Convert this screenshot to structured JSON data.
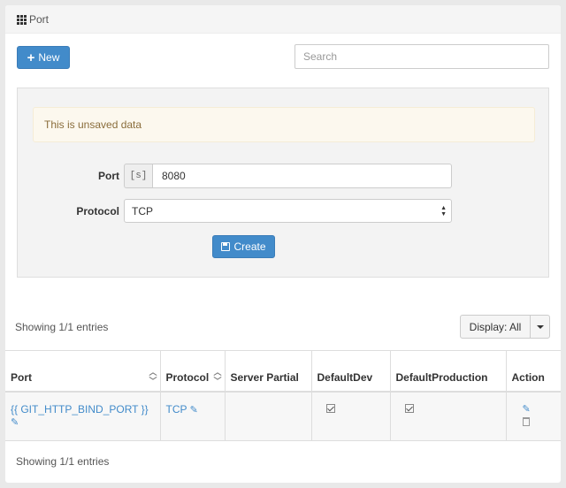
{
  "panel": {
    "title": "Port"
  },
  "toolbar": {
    "new_label": "New"
  },
  "search": {
    "placeholder": "Search"
  },
  "form": {
    "alert": "This is unsaved data",
    "port_label": "Port",
    "port_addon": "[s]",
    "port_value": "8080",
    "protocol_label": "Protocol",
    "protocol_value": "TCP",
    "create_label": "Create"
  },
  "list": {
    "showing_top": "Showing 1/1 entries",
    "display_label": "Display: All",
    "showing_bottom": "Showing 1/1 entries"
  },
  "table": {
    "headers": {
      "port": "Port",
      "protocol": "Protocol",
      "server_partial": "Server Partial",
      "default_dev": "DefaultDev",
      "default_production": "DefaultProduction",
      "action": "Action"
    },
    "rows": [
      {
        "port": "{{ GIT_HTTP_BIND_PORT }}",
        "protocol": "TCP",
        "server_partial": "",
        "default_dev": true,
        "default_production": true
      }
    ]
  },
  "icons": {
    "grid": "grid-icon",
    "plus": "plus-icon",
    "save": "save-icon",
    "pencil": "pencil-icon",
    "checkbox": "checkbox-icon",
    "trash": "trash-icon",
    "caret": "caret-down-icon",
    "sort": "sort-icon"
  },
  "colors": {
    "primary": "#428bca",
    "alert_bg": "#fcf8ee",
    "alert_text": "#8a6d3b"
  }
}
